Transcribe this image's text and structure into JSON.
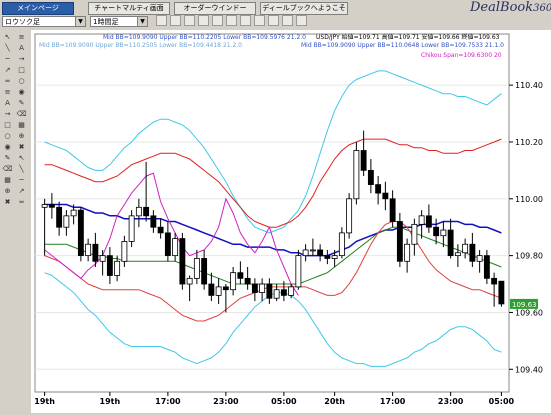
{
  "toolbar": {
    "tabs": [
      "メインページ",
      "チャートマルティ画面",
      "オーダーウインドー",
      "ディールブックへようこそ"
    ],
    "symbol": "ロウソク足",
    "period": "1時間足",
    "logo": "DealBook",
    "logo_num": "360",
    "buttons": [
      "cursor",
      "crosshair",
      "line",
      "hline",
      "vline",
      "text",
      "zoom",
      "settings",
      "print",
      "help",
      "close"
    ]
  },
  "left_tools": [
    "cursor-icon",
    "line-icon",
    "hline-icon",
    "ray-icon",
    "channel-icon",
    "fib-icon",
    "text-icon",
    "arrow-icon",
    "rect-icon",
    "circle-icon",
    "eye-icon",
    "pen-icon",
    "erase-icon",
    "grid-icon",
    "zoom-icon",
    "trash-icon"
  ],
  "chart_data": {
    "type": "candlestick",
    "legend": [
      {
        "text": "Mid BB=109.9090 Upper BB=110.2205 Lower BB=109.5976 21.2.0",
        "color": "#3050c8"
      },
      {
        "text": "USD/JPY 始値=109.71 高値=109.71 安値=109.66 終値=109.63",
        "color": "#000000"
      },
      {
        "text": "Mid BB=109.9090 Upper BB=110.2505 Lower BB=109.4418 21.2.0",
        "color": "#6ea6d8"
      },
      {
        "text": "Mid BB=109.9090 Upper BB=110.0648 Lower BB=109.7533 21.1.0",
        "color": "#3050c8"
      },
      {
        "text": "Chikou Span=109.6300 20",
        "color": "#d020c8"
      }
    ],
    "y_ticks": [
      "110.40",
      "110.20",
      "110.00",
      "109.80",
      "109.60",
      "109.40"
    ],
    "ylim": [
      109.32,
      110.58
    ],
    "last_price": "109.63",
    "x_ticks": [
      "19th",
      "19th",
      "17:00",
      "23:00",
      "05:00",
      "20th",
      "17:00",
      "23:00",
      "05:00"
    ],
    "candles": [
      [
        109.97,
        110.0,
        109.8,
        109.98
      ],
      [
        109.98,
        110.02,
        109.93,
        109.97
      ],
      [
        109.97,
        109.99,
        109.87,
        109.9
      ],
      [
        109.9,
        109.96,
        109.87,
        109.94
      ],
      [
        109.94,
        109.98,
        109.91,
        109.96
      ],
      [
        109.96,
        109.97,
        109.78,
        109.8
      ],
      [
        109.8,
        109.86,
        109.78,
        109.84
      ],
      [
        109.84,
        109.88,
        109.76,
        109.78
      ],
      [
        109.78,
        109.82,
        109.73,
        109.8
      ],
      [
        109.8,
        109.83,
        109.7,
        109.73
      ],
      [
        109.73,
        109.8,
        109.71,
        109.78
      ],
      [
        109.78,
        109.87,
        109.76,
        109.85
      ],
      [
        109.85,
        109.96,
        109.83,
        109.94
      ],
      [
        109.94,
        110.0,
        109.9,
        109.97
      ],
      [
        109.97,
        110.13,
        109.92,
        109.94
      ],
      [
        109.94,
        109.96,
        109.88,
        109.9
      ],
      [
        109.9,
        109.93,
        109.86,
        109.88
      ],
      [
        109.88,
        109.92,
        109.78,
        109.8
      ],
      [
        109.8,
        109.88,
        109.78,
        109.86
      ],
      [
        109.86,
        109.88,
        109.68,
        109.7
      ],
      [
        109.7,
        109.73,
        109.64,
        109.72
      ],
      [
        109.72,
        109.82,
        109.7,
        109.79
      ],
      [
        109.79,
        109.82,
        109.68,
        109.7
      ],
      [
        109.7,
        109.74,
        109.64,
        109.66
      ],
      [
        109.66,
        109.72,
        109.63,
        109.69
      ],
      [
        109.69,
        109.7,
        109.6,
        109.68
      ],
      [
        109.68,
        109.76,
        109.66,
        109.74
      ],
      [
        109.74,
        109.78,
        109.7,
        109.72
      ],
      [
        109.72,
        109.76,
        109.68,
        109.7
      ],
      [
        109.7,
        109.72,
        109.64,
        109.67
      ],
      [
        109.67,
        109.72,
        109.64,
        109.7
      ],
      [
        109.7,
        109.72,
        109.63,
        109.65
      ],
      [
        109.65,
        109.7,
        109.64,
        109.68
      ],
      [
        109.68,
        109.71,
        109.64,
        109.66
      ],
      [
        109.66,
        109.7,
        109.65,
        109.69
      ],
      [
        109.69,
        109.82,
        109.68,
        109.8
      ],
      [
        109.8,
        109.84,
        109.78,
        109.82
      ],
      [
        109.82,
        109.86,
        109.8,
        109.82
      ],
      [
        109.82,
        109.84,
        109.78,
        109.8
      ],
      [
        109.8,
        109.82,
        109.77,
        109.79
      ],
      [
        109.79,
        109.82,
        109.76,
        109.8
      ],
      [
        109.8,
        109.9,
        109.79,
        109.88
      ],
      [
        109.88,
        110.02,
        109.86,
        110.0
      ],
      [
        110.0,
        110.2,
        109.98,
        110.17
      ],
      [
        110.17,
        110.24,
        110.08,
        110.1
      ],
      [
        110.1,
        110.14,
        110.02,
        110.05
      ],
      [
        110.05,
        110.08,
        109.98,
        110.02
      ],
      [
        110.02,
        110.06,
        109.96,
        110.0
      ],
      [
        110.0,
        110.03,
        109.9,
        109.92
      ],
      [
        109.92,
        109.95,
        109.76,
        109.78
      ],
      [
        109.78,
        109.86,
        109.74,
        109.84
      ],
      [
        109.84,
        109.93,
        109.8,
        109.91
      ],
      [
        109.91,
        109.96,
        109.86,
        109.94
      ],
      [
        109.94,
        109.98,
        109.88,
        109.9
      ],
      [
        109.9,
        109.93,
        109.84,
        109.87
      ],
      [
        109.87,
        109.92,
        109.83,
        109.89
      ],
      [
        109.89,
        109.93,
        109.79,
        109.8
      ],
      [
        109.8,
        109.84,
        109.76,
        109.81
      ],
      [
        109.81,
        109.86,
        109.79,
        109.84
      ],
      [
        109.84,
        109.88,
        109.76,
        109.78
      ],
      [
        109.78,
        109.82,
        109.74,
        109.8
      ],
      [
        109.8,
        109.82,
        109.7,
        109.72
      ],
      [
        109.72,
        109.74,
        109.62,
        109.7
      ],
      [
        109.71,
        109.71,
        109.62,
        109.63
      ]
    ],
    "series": [
      {
        "key": "bb2_upper",
        "color": "#40c8e8",
        "values": [
          110.2,
          110.19,
          110.18,
          110.17,
          110.15,
          110.13,
          110.11,
          110.1,
          110.1,
          110.12,
          110.15,
          110.18,
          110.2,
          110.23,
          110.25,
          110.27,
          110.28,
          110.28,
          110.27,
          110.26,
          110.24,
          110.21,
          110.18,
          110.14,
          110.1,
          110.06,
          110.01,
          109.97,
          109.93,
          109.9,
          109.89,
          109.88,
          109.89,
          109.9,
          109.93,
          109.96,
          110.01,
          110.08,
          110.16,
          110.24,
          110.31,
          110.36,
          110.4,
          110.42,
          110.43,
          110.44,
          110.45,
          110.45,
          110.44,
          110.43,
          110.42,
          110.41,
          110.4,
          110.39,
          110.38,
          110.37,
          110.37,
          110.36,
          110.36,
          110.35,
          110.34,
          110.33,
          110.35,
          110.37
        ]
      },
      {
        "key": "bb1_upper",
        "color": "#e02020",
        "values": [
          110.12,
          110.12,
          110.11,
          110.1,
          110.09,
          110.08,
          110.07,
          110.06,
          110.06,
          110.07,
          110.08,
          110.1,
          110.12,
          110.13,
          110.14,
          110.15,
          110.16,
          110.16,
          110.16,
          110.15,
          110.14,
          110.12,
          110.1,
          110.08,
          110.06,
          110.03,
          110.0,
          109.97,
          109.94,
          109.92,
          109.91,
          109.9,
          109.9,
          109.91,
          109.92,
          109.94,
          109.97,
          110.01,
          110.06,
          110.1,
          110.14,
          110.17,
          110.19,
          110.2,
          110.21,
          110.21,
          110.21,
          110.21,
          110.2,
          110.19,
          110.19,
          110.18,
          110.18,
          110.17,
          110.17,
          110.16,
          110.16,
          110.16,
          110.17,
          110.17,
          110.18,
          110.19,
          110.2,
          110.21
        ]
      },
      {
        "key": "bb_mid",
        "color": "#1010c0",
        "values": [
          109.98,
          109.98,
          109.98,
          109.98,
          109.97,
          109.97,
          109.96,
          109.95,
          109.95,
          109.94,
          109.94,
          109.93,
          109.93,
          109.93,
          109.93,
          109.93,
          109.93,
          109.92,
          109.92,
          109.91,
          109.9,
          109.89,
          109.88,
          109.87,
          109.86,
          109.85,
          109.84,
          109.84,
          109.83,
          109.83,
          109.83,
          109.83,
          109.82,
          109.82,
          109.81,
          109.81,
          109.8,
          109.8,
          109.8,
          109.8,
          109.81,
          109.82,
          109.83,
          109.85,
          109.86,
          109.87,
          109.88,
          109.89,
          109.89,
          109.9,
          109.9,
          109.9,
          109.91,
          109.91,
          109.91,
          109.92,
          109.92,
          109.92,
          109.91,
          109.91,
          109.9,
          109.9,
          109.89,
          109.88
        ]
      },
      {
        "key": "bb1_lower",
        "color": "#208020",
        "values": [
          109.84,
          109.84,
          109.84,
          109.84,
          109.83,
          109.82,
          109.81,
          109.8,
          109.8,
          109.79,
          109.79,
          109.78,
          109.78,
          109.78,
          109.78,
          109.78,
          109.78,
          109.78,
          109.78,
          109.77,
          109.76,
          109.75,
          109.74,
          109.73,
          109.72,
          109.71,
          109.7,
          109.7,
          109.7,
          109.7,
          109.7,
          109.7,
          109.7,
          109.7,
          109.7,
          109.7,
          109.71,
          109.72,
          109.73,
          109.74,
          109.76,
          109.78,
          109.8,
          109.82,
          109.84,
          109.86,
          109.88,
          109.89,
          109.9,
          109.9,
          109.89,
          109.88,
          109.87,
          109.86,
          109.85,
          109.84,
          109.83,
          109.82,
          109.81,
          109.8,
          109.79,
          109.78,
          109.77,
          109.76
        ]
      },
      {
        "key": "bb2_lower",
        "color": "#e04040",
        "values": [
          109.8,
          109.79,
          109.78,
          109.76,
          109.74,
          109.72,
          109.7,
          109.69,
          109.68,
          109.68,
          109.68,
          109.68,
          109.68,
          109.68,
          109.67,
          109.66,
          109.65,
          109.63,
          109.61,
          109.59,
          109.58,
          109.57,
          109.57,
          109.58,
          109.59,
          109.61,
          109.63,
          109.65,
          109.66,
          109.67,
          109.68,
          109.69,
          109.69,
          109.69,
          109.69,
          109.69,
          109.69,
          109.68,
          109.67,
          109.66,
          109.66,
          109.67,
          109.7,
          109.74,
          109.79,
          109.84,
          109.88,
          109.91,
          109.92,
          109.92,
          109.9,
          109.86,
          109.82,
          109.78,
          109.75,
          109.73,
          109.71,
          109.7,
          109.69,
          109.68,
          109.68,
          109.67,
          109.66,
          109.65
        ]
      },
      {
        "key": "bb3_lower",
        "color": "#40c8e8",
        "values": [
          109.74,
          109.73,
          109.71,
          109.69,
          109.67,
          109.64,
          109.61,
          109.59,
          109.56,
          109.53,
          109.51,
          109.49,
          109.48,
          109.48,
          109.48,
          109.48,
          109.48,
          109.47,
          109.46,
          109.44,
          109.43,
          109.42,
          109.43,
          109.44,
          109.46,
          109.49,
          109.53,
          109.56,
          109.59,
          109.62,
          109.64,
          109.66,
          109.67,
          109.67,
          109.66,
          109.64,
          109.61,
          109.57,
          109.53,
          109.49,
          109.46,
          109.44,
          109.43,
          109.42,
          109.42,
          109.41,
          109.41,
          109.41,
          109.42,
          109.43,
          109.44,
          109.46,
          109.47,
          109.49,
          109.5,
          109.52,
          109.54,
          109.55,
          109.55,
          109.54,
          109.52,
          109.5,
          109.47,
          109.46
        ]
      },
      {
        "key": "chikou",
        "color": "#d020c8",
        "values": [
          109.82,
          109.8,
          109.78,
          109.76,
          109.74,
          109.72,
          109.75,
          109.77,
          109.8,
          109.86,
          109.94,
          109.98,
          110.02,
          110.05,
          110.08,
          110.09,
          109.99,
          109.93,
          109.88,
          109.83,
          109.8,
          109.81,
          109.82,
          109.85,
          109.9,
          110.0,
          109.95,
          109.88,
          109.84,
          109.81,
          109.85,
          109.9,
          109.82,
          109.76,
          109.7,
          109.66,
          null,
          null,
          null,
          null,
          null,
          null,
          null,
          null,
          null,
          null,
          null,
          null,
          null,
          null,
          null,
          null,
          null,
          null,
          null,
          null,
          null,
          null,
          null,
          null,
          null,
          null,
          null,
          null
        ]
      }
    ]
  }
}
